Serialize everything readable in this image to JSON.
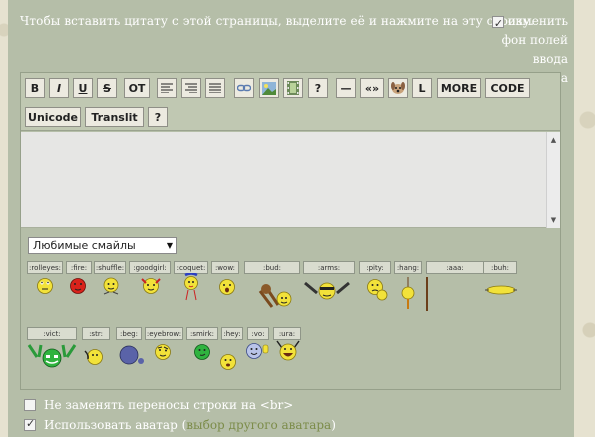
{
  "hint": "Чтобы вставить цитату с этой страницы, выделите её и нажмите на эту строку.",
  "bg_option": {
    "line1": "изменить",
    "line2": "фон полей",
    "line3": "ввода текста",
    "checked": true
  },
  "toolbar": {
    "row1": [
      "B",
      "I",
      "U",
      "S",
      "OT",
      "align-left-icon",
      "align-right-icon",
      "align-justify-icon",
      "link-icon",
      "image-icon",
      "video-icon",
      "?",
      "—",
      "«»",
      "smiley-icon",
      "L",
      "MORE",
      "CODE"
    ],
    "row2": [
      "Unicode",
      "Translit",
      "?"
    ]
  },
  "smiley_select": {
    "selected": "Любимые смайлы"
  },
  "smileys_row1": [
    ":rolleyes:",
    ":fire:",
    ":shuffle:",
    ":goodgirl:",
    ":coquet:",
    ":wow:",
    ":bud:",
    ":arms:",
    ":pity:",
    ":hang:",
    ":aaa:",
    ":buh:"
  ],
  "smileys_row2": [
    ":vict:",
    ":str:",
    ":beg:",
    ":eyebrow:",
    ":smirk:",
    ":hey:",
    ":vo:",
    ":ura:"
  ],
  "options": {
    "no_br": {
      "label": "Не заменять переносы строки на <br>",
      "checked": false
    },
    "avatar": {
      "label": "Использовать аватар",
      "link": "выбор другого аватара",
      "checked": true
    }
  },
  "colors": {
    "panel": "#b5bea8",
    "toolbar": "#c0c8b2",
    "smiley": "#f2e23a"
  }
}
